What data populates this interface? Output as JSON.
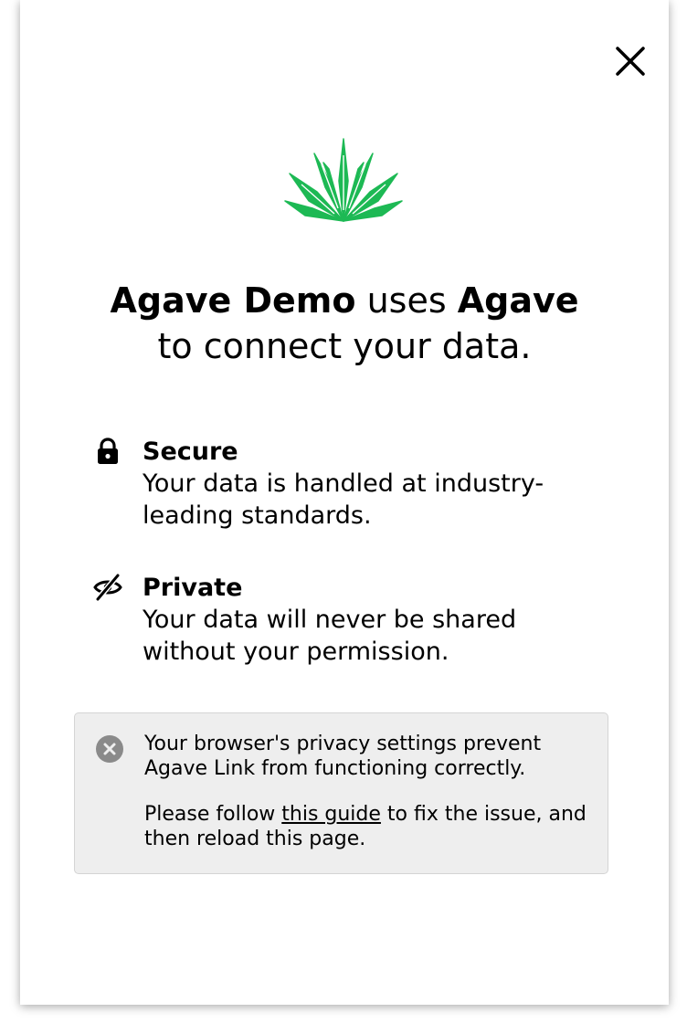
{
  "headline": {
    "app_name": "Agave Demo",
    "uses": " uses ",
    "brand": "Agave",
    "line2": "to connect your data."
  },
  "features": [
    {
      "icon": "lock-icon",
      "title": "Secure",
      "description": "Your data is handled at industry-leading standards."
    },
    {
      "icon": "eye-slash-icon",
      "title": "Private",
      "description": "Your data will never be shared without your permission."
    }
  ],
  "notice": {
    "icon": "error-circle-icon",
    "message": "Your browser's privacy settings prevent Agave Link from functioning correctly.",
    "follow_prefix": "Please follow ",
    "link_text": "this guide",
    "follow_suffix": " to fix the issue, and then reload this page."
  },
  "colors": {
    "brand_green": "#1db954",
    "notice_bg": "#eeeeee",
    "notice_border": "#d4d4d4",
    "error_icon": "#8a8a8a"
  },
  "icons": {
    "close": "close-icon",
    "logo": "agave-logo-icon"
  }
}
